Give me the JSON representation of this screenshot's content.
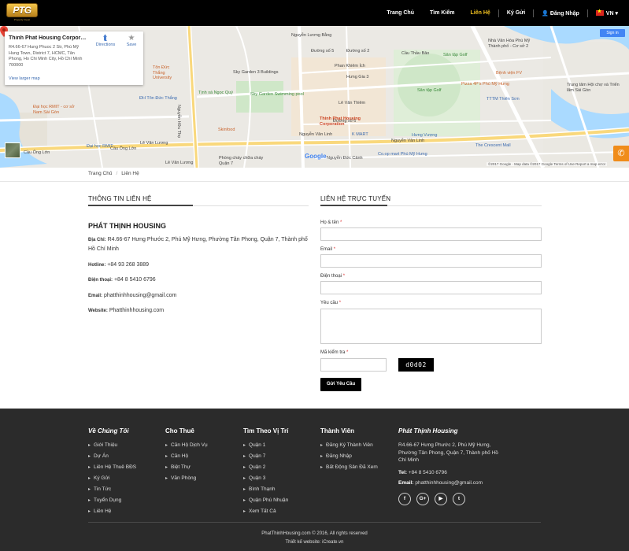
{
  "nav": {
    "logo_text": "PTG",
    "logo_sub": "Property Invest",
    "items": [
      {
        "label": "Trang Chủ",
        "active": false
      },
      {
        "label": "Tìm Kiếm",
        "active": false
      },
      {
        "label": "Liên Hệ",
        "active": true
      },
      {
        "label": "Ký Gửi",
        "active": false
      },
      {
        "label": "Đăng Nhập",
        "active": false
      }
    ],
    "lang": "VN"
  },
  "map": {
    "card_title": "Thinh Phat Housing Corporati...",
    "card_address": "R4.66-67 Hung Phuoc 2 Str, Phú Mỹ Hung Town, District 7, HCMC, Tân Phong, Ho Chi Minh City, Hồ Chí Minh 700000",
    "card_link": "View larger map",
    "directions_label": "Directions",
    "save_label": "Save",
    "signin_label": "Sign in",
    "pin_label": "Thinh Phat Housing Corporation",
    "google_label": "Google",
    "footer_text": "©2017 Google · Map data ©2017 Google   Terms of Use   Report a map error",
    "labels": {
      "sky_garden_3": "Sky Garden 3 Buildings",
      "sky_garden_pool": "Sky Garden Swimming pool",
      "phan_khiem_ich": "Phan Khiêm Ích",
      "hung_gia_3": "Hưng Gia 3",
      "le_van_thiem": "Lê Văn Thiêm",
      "duong_so_6": "Đường số 6",
      "duong_so_5": "Đường số 5",
      "duong_so_2": "Đường số 2",
      "nguyen_van_linh": "Nguyễn Văn Linh",
      "k_mart": "K MART",
      "skinfood": "Skinfood",
      "ton_duc_thang": "Tôn Đức Thắng University",
      "dh_ton_duc_thang": "ĐH Tôn Đức Thắng",
      "rmit": "Đại học RMIT - cơ sở Nam Sài Gòn",
      "dai_hoc_rmit": "Đại học RMIT",
      "cau_ong_lon": "Cầu Ông Lớn",
      "tinh_xa": "Tịnh xá Ngọc Quý",
      "nguyen_huu_tho": "Nguyễn Hữu Thọ",
      "san_tap_golf": "Sân tập Golf",
      "pizza_4ps": "Pizza 4P's Phú Mỹ Hưng",
      "benh_vien_fv": "Bệnh viện FV",
      "tttm": "TTTM Thiên Sơn",
      "crescent_mall": "The Crescent Mall",
      "hung_vuong": "Hưng Vượng",
      "nha_van_hoa": "Nhà Văn Hóa Phú Mỹ Thành phố - Cơ sở 2",
      "trung_tam_hoi_cho": "Trung tâm Hội chợ và Triển lãm Sài Gòn",
      "le_van_luong": "Lê Văn Lương",
      "nguyen_luong_bang": "Nguyễn Lương Bằng",
      "nguyen_duc_canh": "Nguyễn Đức Cảnh",
      "phong_chay": "Phòng cháy chữa cháy Quận 7",
      "cau_tham_luong": "Cầu Thầu Bảo",
      "co_op_mart": "Co.op mart Phú Mỹ Hưng"
    }
  },
  "breadcrumb": [
    "Trang Chủ",
    "Liên Hệ"
  ],
  "contact_info": {
    "heading": "THÔNG TIN LIÊN HỆ",
    "company": "PHÁT THỊNH HOUSING",
    "address_label": "Địa Chỉ:",
    "address": "R4.66-67 Hưng Phước 2, Phú Mỹ Hưng, Phường Tân Phong, Quận 7, Thành phố Hồ Chí Minh",
    "hotline_label": "Hotline:",
    "hotline": "+84 93 268 3889",
    "phone_label": "Điện thoại:",
    "phone": "+84 8 5410 6796",
    "email_label": "Email:",
    "email": "phatthinhhousing@gmail.com",
    "website_label": "Website:",
    "website": "Phatthinhhousing.com"
  },
  "form": {
    "heading": "LIÊN HỆ TRỰC TUYẾN",
    "name_label": "Họ & tên",
    "email_label": "Email",
    "phone_label": "Điện thoại",
    "request_label": "Yêu cầu",
    "captcha_label": "Mã kiểm tra",
    "req_mark": "*",
    "captcha_text": "d0d02",
    "submit_label": "Gửi Yêu Cầu"
  },
  "footer": {
    "col1": {
      "title": "Về Chúng Tôi",
      "items": [
        "Giới Thiệu",
        "Dự Án",
        "Liên Hệ Thuê BĐS",
        "Ký Gửi",
        "Tin Tức",
        "Tuyển Dụng",
        "Liên Hệ"
      ]
    },
    "col2": {
      "title": "Cho Thuê",
      "items": [
        "Căn Hộ Dịch Vụ",
        "Căn Hộ",
        "Biệt Thự",
        "Văn Phòng"
      ]
    },
    "col3": {
      "title": "Tìm Theo Vị Trí",
      "items": [
        "Quận 1",
        "Quận 7",
        "Quận 2",
        "Quận 3",
        "Bình Thạnh",
        "Quận Phú Nhuận",
        "Xem Tất Cả"
      ]
    },
    "col4": {
      "title": "Thành Viên",
      "items": [
        "Đăng Ký Thành Viên",
        "Đăng Nhập",
        "Bất Động Sản Đã Xem"
      ]
    },
    "col5": {
      "title": "Phát Thịnh Housing",
      "address": "R4.66-67 Hưng Phước 2, Phú Mỹ Hưng, Phường Tân Phong, Quận 7, Thành phố Hồ Chí Minh",
      "tel_label": "Tel:",
      "tel": "+84 8 5410 6796",
      "email_label": "Email:",
      "email": "phatthinhhousing@gmail.com"
    },
    "social": [
      "f",
      "G+",
      "▶",
      "t"
    ],
    "copyright": "PhatThinhHousing.com © 2016, All rights reserved",
    "designer": "Thiết kế website: iCreate.vn"
  }
}
